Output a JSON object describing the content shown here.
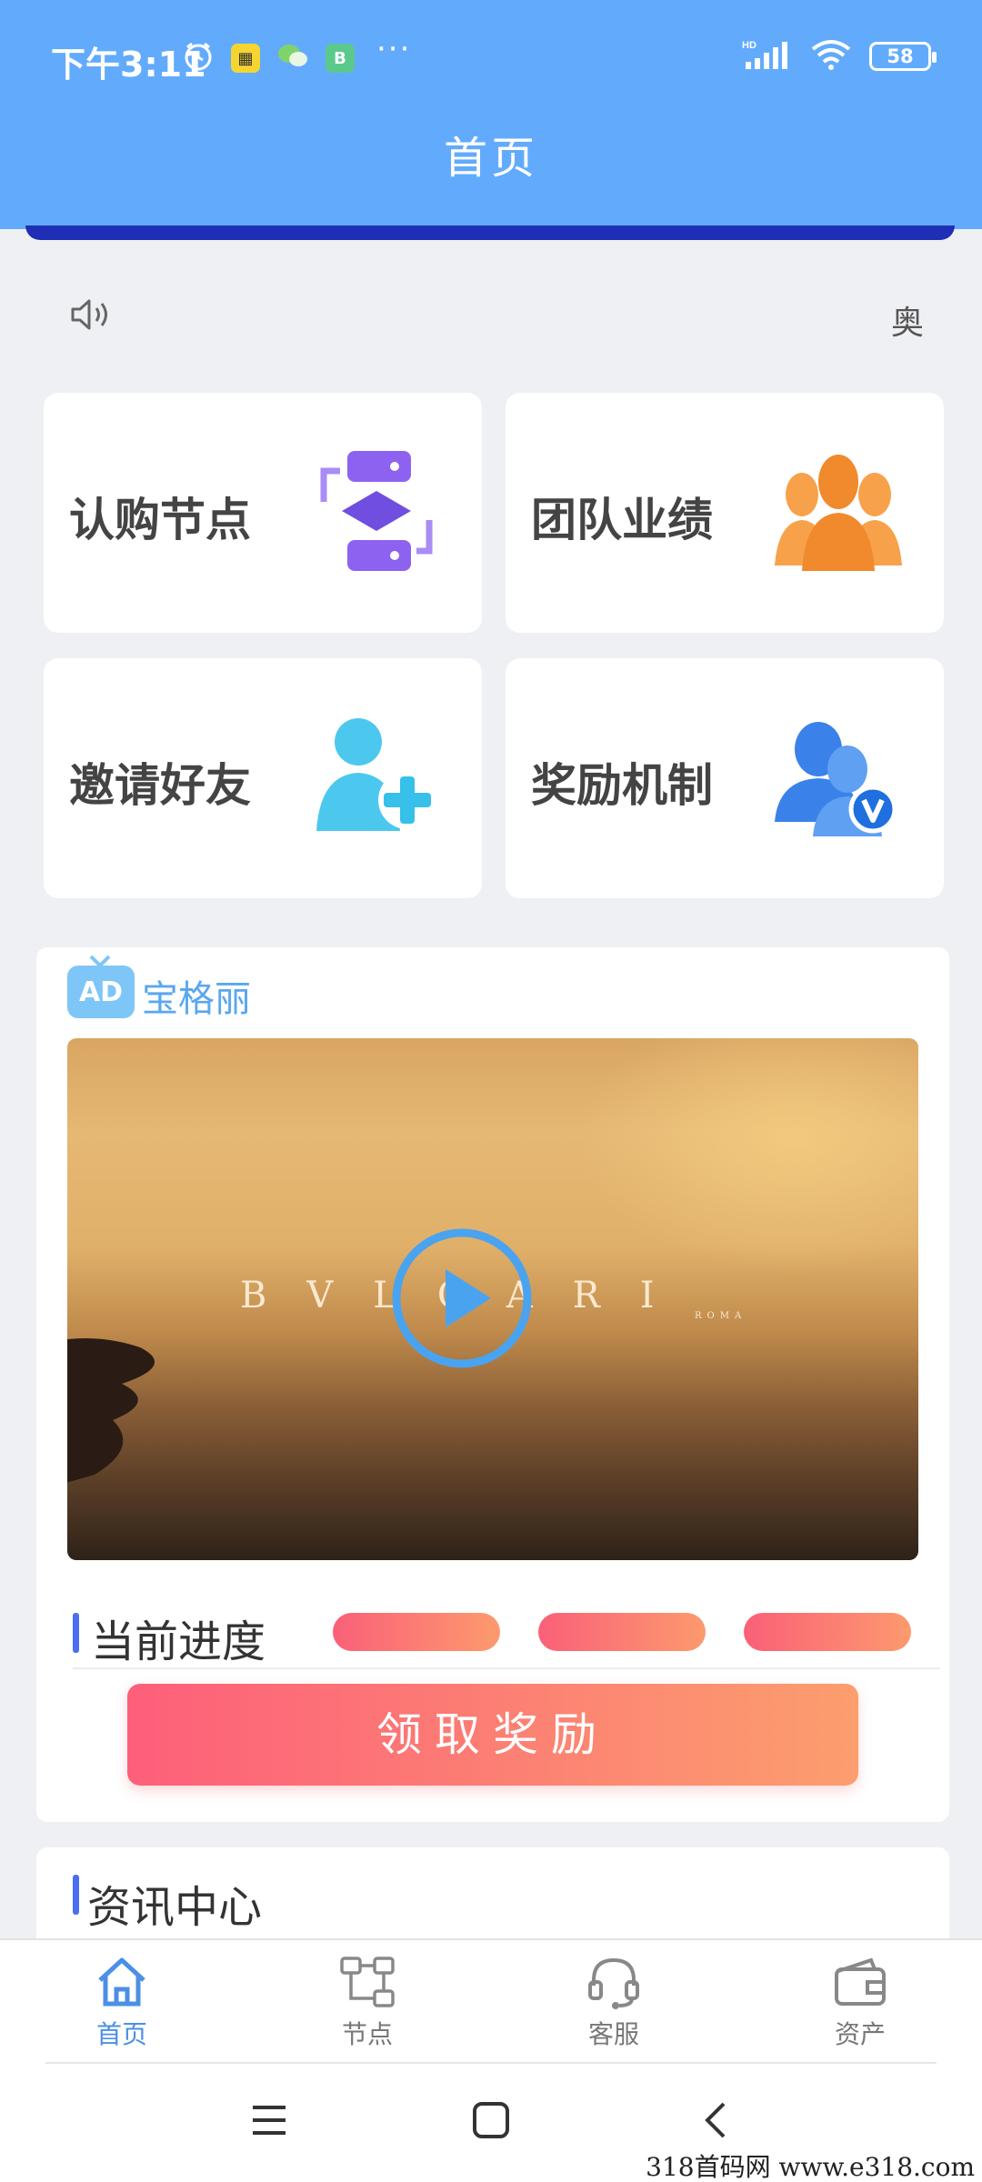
{
  "status_bar": {
    "time": "下午3:11",
    "network": "HD",
    "battery": "58"
  },
  "header": {
    "title": "首页"
  },
  "notice": {
    "text": "奥"
  },
  "menu": [
    {
      "label": "认购节点",
      "icon": "subscribe-node-icon",
      "color": "#8b5cf6"
    },
    {
      "label": "团队业绩",
      "icon": "team-performance-icon",
      "color": "#f59a3a"
    },
    {
      "label": "邀请好友",
      "icon": "invite-friend-icon",
      "color": "#4fc9ef"
    },
    {
      "label": "奖励机制",
      "icon": "reward-mechanism-icon",
      "color": "#3f86ec"
    }
  ],
  "ad": {
    "badge": "AD",
    "title": "宝格丽",
    "video_brand": "BVLGARI",
    "video_sub": "ROMA"
  },
  "progress": {
    "label": "当前进度",
    "claim_button": "领取奖励"
  },
  "news": {
    "title": "资讯中心"
  },
  "tabbar": {
    "items": [
      {
        "label": "首页",
        "icon": "home-icon",
        "active": true
      },
      {
        "label": "节点",
        "icon": "node-icon",
        "active": false
      },
      {
        "label": "客服",
        "icon": "headset-icon",
        "active": false
      },
      {
        "label": "资产",
        "icon": "wallet-icon",
        "active": false
      }
    ]
  },
  "watermark": "318首码网  www.e318.com",
  "colors": {
    "header": "#62abfc",
    "accent": "#4b6ff2",
    "claim_gradient_start": "#fd5f7a",
    "claim_gradient_end": "#fc9e6e",
    "tab_active": "#4b8fe6"
  }
}
